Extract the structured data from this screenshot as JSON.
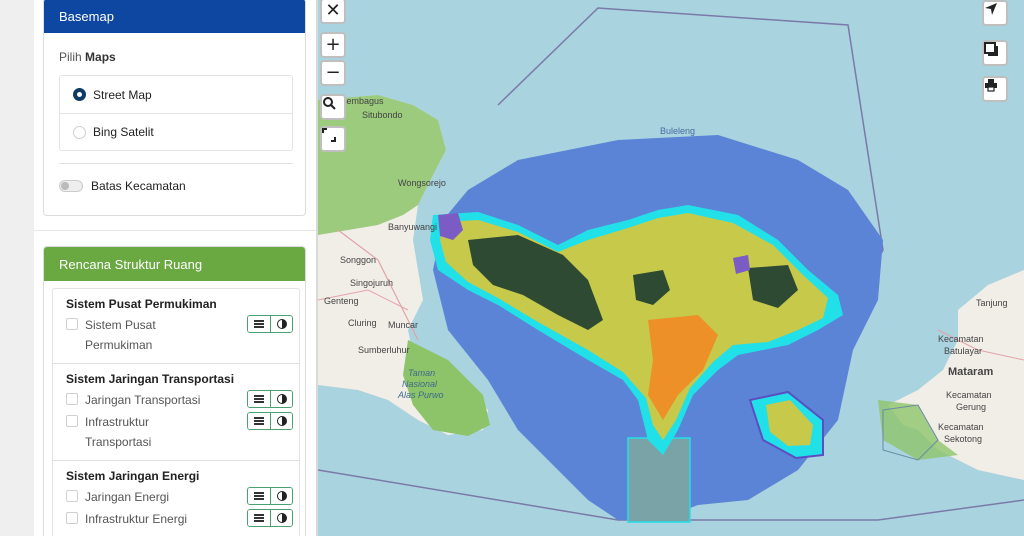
{
  "basemap": {
    "header": "Basemap",
    "pilih_prefix": "Pilih",
    "pilih_bold": "Maps",
    "options": [
      {
        "label": "Street Map",
        "selected": true
      },
      {
        "label": "Bing Satelit",
        "selected": false
      }
    ],
    "toggle_label": "Batas Kecamatan",
    "toggle_on": false
  },
  "rencana": {
    "header": "Rencana Struktur Ruang",
    "sections": [
      {
        "title": "Sistem Pusat Permukiman",
        "items": [
          "Sistem Pusat Permukiman"
        ]
      },
      {
        "title": "Sistem Jaringan Transportasi",
        "items": [
          "Jaringan Transportasi",
          "Infrastruktur Transportasi"
        ]
      },
      {
        "title": "Sistem Jaringan Energi",
        "items": [
          "Jaringan Energi",
          "Infrastruktur Energi"
        ]
      }
    ]
  },
  "map": {
    "labels": {
      "sembagus": "sembagus",
      "situbondo": "Situbondo",
      "buleleng": "Buleleng",
      "wongsorejo": "Wongsorejo",
      "banyuwangi": "Banyuwangi",
      "songgon": "Songgon",
      "singojuruh": "Singojuruh",
      "genteng": "Genteng",
      "cluring": "Cluring",
      "muncar": "Muncar",
      "sumberluhur": "Sumberluhur",
      "taman": "Taman",
      "nasional": "Nasional",
      "alas_purwo": "Alas Purwo",
      "tanjung": "Tanjung",
      "kec_batulayar_1": "Kecamatan",
      "kec_batulayar_2": "Batulayar",
      "mataram": "Mataram",
      "kec_gerung_1": "Kecamatan",
      "kec_gerung_2": "Gerung",
      "kec_sekotong_1": "Kecamatan",
      "kec_sekotong_2": "Sekotong"
    },
    "colors": {
      "sea": "#a9d3df",
      "zone_blue": "#5b84d6",
      "cyan": "#22e0e8",
      "land_yellow": "#c7c94a",
      "forest": "#2f4a32",
      "orange": "#ef8a24",
      "purple": "#7a5cc4",
      "land_green": "#7dbb62"
    },
    "controls": [
      "close-icon",
      "zoom-in-icon",
      "zoom-out-icon",
      "search-icon",
      "expand-icon",
      "locate-icon",
      "layers-icon",
      "print-icon"
    ]
  }
}
